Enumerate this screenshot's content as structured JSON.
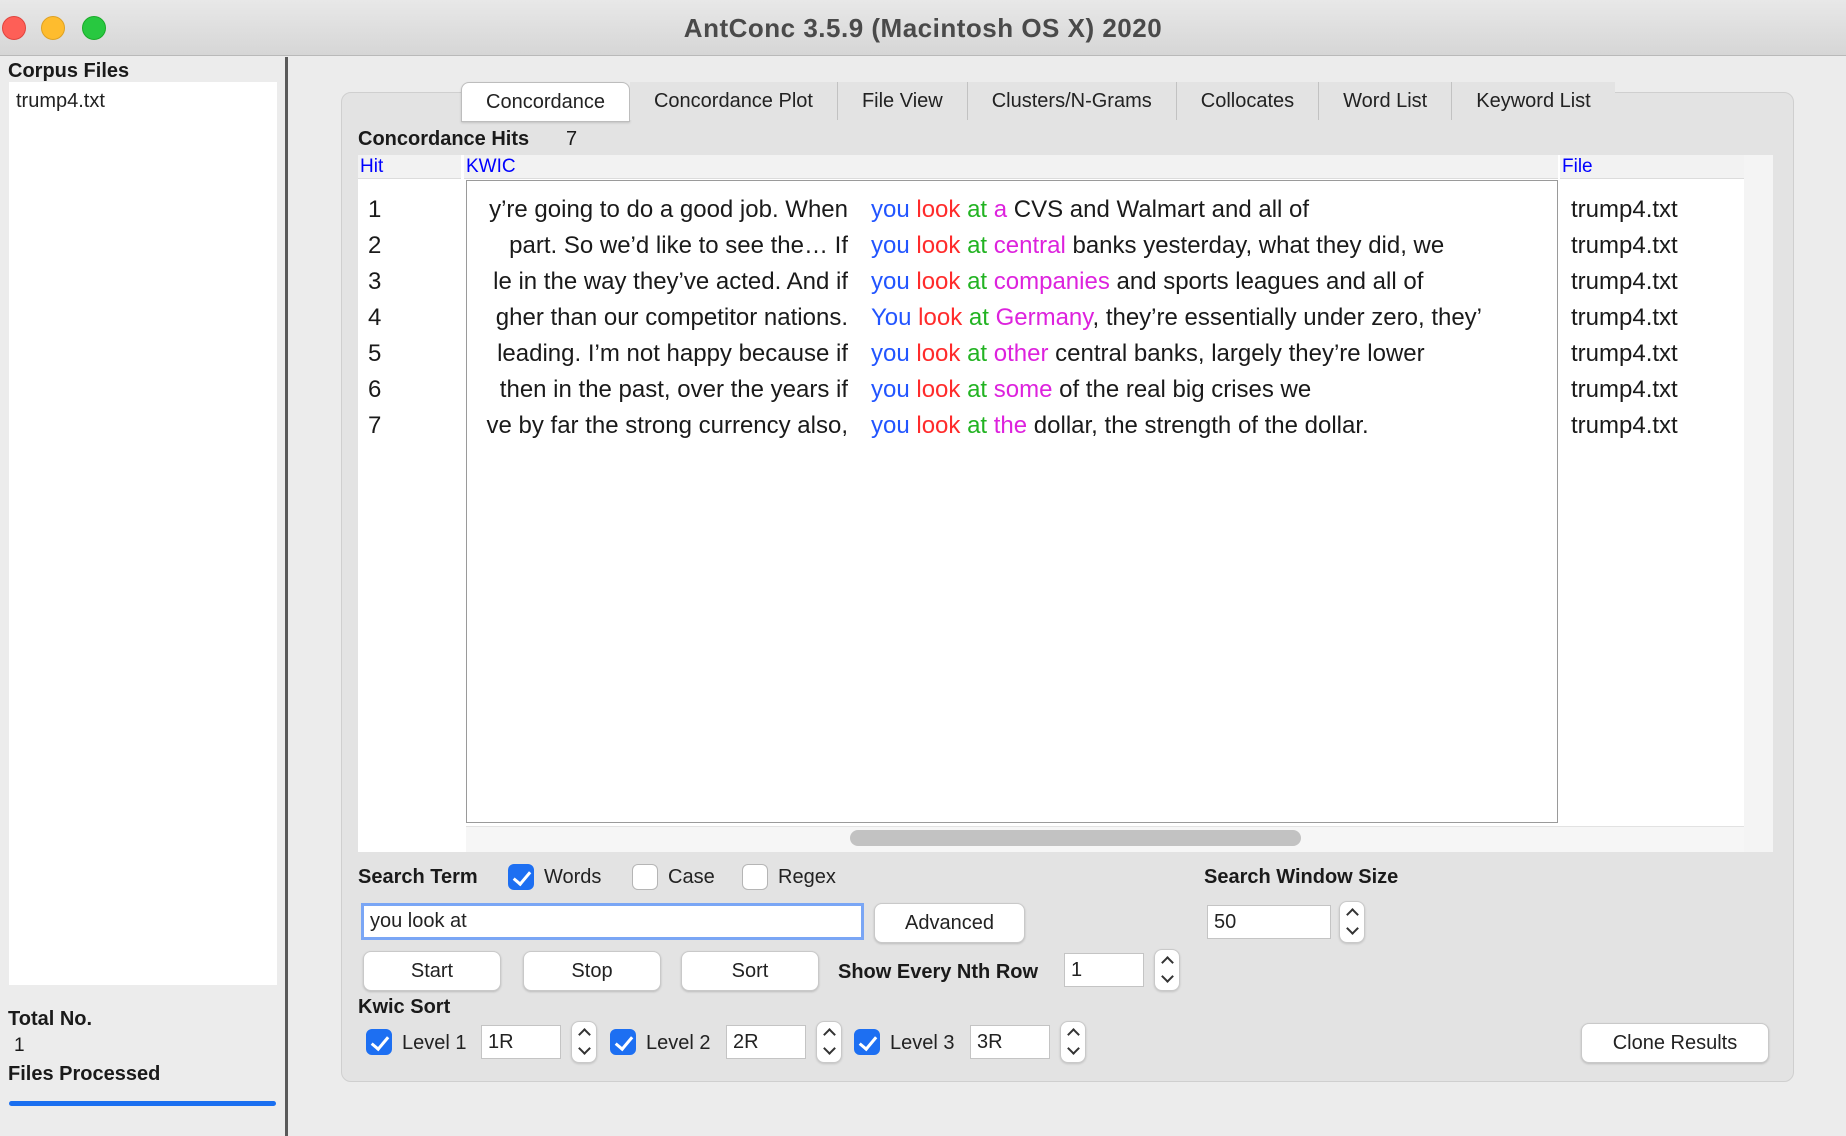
{
  "window": {
    "title": "AntConc 3.5.9 (Macintosh OS X) 2020"
  },
  "sidebar": {
    "corpus_label": "Corpus Files",
    "files": [
      "trump4.txt"
    ],
    "total_label": "Total No.",
    "total_value": "1",
    "processed_label": "Files Processed"
  },
  "tabs": [
    "Concordance",
    "Concordance Plot",
    "File View",
    "Clusters/N-Grams",
    "Collocates",
    "Word List",
    "Keyword List"
  ],
  "concordance": {
    "hits_label": "Concordance Hits",
    "hits_count": "7",
    "col_hit": "Hit",
    "col_kwic": "KWIC",
    "col_file": "File",
    "rows": [
      {
        "hit": "1",
        "left": "y’re going to do a good job. When",
        "k1": "you",
        "k2": "look",
        "k3": "at",
        "k4": "a",
        "rest": " CVS and Walmart and all of",
        "file": "trump4.txt"
      },
      {
        "hit": "2",
        "left": "part. So we’d like to see the… If",
        "k1": "you",
        "k2": "look",
        "k3": "at",
        "k4": "central",
        "rest": " banks yesterday, what they did, we",
        "file": "trump4.txt"
      },
      {
        "hit": "3",
        "left": "le in the way they’ve acted. And if",
        "k1": "you",
        "k2": "look",
        "k3": "at",
        "k4": "companies",
        "rest": " and sports leagues and all of",
        "file": "trump4.txt"
      },
      {
        "hit": "4",
        "left": "gher than our competitor nations.",
        "k1": "You",
        "k2": "look",
        "k3": "at",
        "k4": "Germany",
        "rest": ", they’re essentially under zero, they’",
        "file": "trump4.txt"
      },
      {
        "hit": "5",
        "left": "leading. I’m not happy because if",
        "k1": "you",
        "k2": "look",
        "k3": "at",
        "k4": "other",
        "rest": " central banks, largely they’re lower",
        "file": "trump4.txt"
      },
      {
        "hit": "6",
        "left": "then in the past, over the years if",
        "k1": "you",
        "k2": "look",
        "k3": "at",
        "k4": "some",
        "rest": " of the real big crises we",
        "file": "trump4.txt"
      },
      {
        "hit": "7",
        "left": "ve by far the strong currency also,",
        "k1": "you",
        "k2": "look",
        "k3": "at",
        "k4": "the",
        "rest": " dollar, the strength of the dollar.",
        "file": "trump4.txt"
      }
    ]
  },
  "search": {
    "term_label": "Search Term",
    "words_label": "Words",
    "case_label": "Case",
    "regex_label": "Regex",
    "words_checked": true,
    "case_checked": false,
    "regex_checked": false,
    "term_value": "you look at",
    "advanced_label": "Advanced",
    "window_label": "Search Window Size",
    "window_value": "50",
    "start_label": "Start",
    "stop_label": "Stop",
    "sort_label": "Sort",
    "nth_label": "Show Every Nth Row",
    "nth_value": "1"
  },
  "kwic_sort": {
    "label": "Kwic Sort",
    "level1_label": "Level 1",
    "level1_value": "1R",
    "level2_label": "Level 2",
    "level2_value": "2R",
    "level3_label": "Level 3",
    "level3_value": "3R",
    "clone_label": "Clone Results"
  },
  "colors": {
    "kw1": "#2255ff",
    "kw2": "#ff2b2b",
    "kw3": "#22b322",
    "kw4": "#dd22dd",
    "header_text": "#0000ff",
    "check_on": "#1d6ff2"
  }
}
